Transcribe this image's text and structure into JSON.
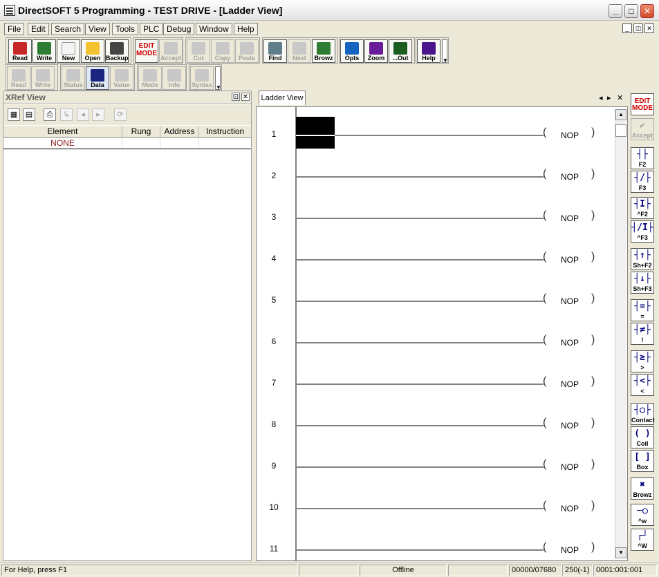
{
  "window": {
    "title": "DirectSOFT 5 Programming - TEST DRIVE - [Ladder View]",
    "minimize": "_",
    "maximize": "□",
    "close": "✕"
  },
  "menu": [
    "File",
    "Edit",
    "Search",
    "View",
    "Tools",
    "PLC",
    "Debug",
    "Window",
    "Help"
  ],
  "toolbar1": [
    {
      "label": "Read",
      "icon": "read-icon",
      "color": "#c62828",
      "enabled": true
    },
    {
      "label": "Write",
      "icon": "write-icon",
      "color": "#2e7d32",
      "enabled": true
    },
    {
      "label": "New",
      "icon": "new-document-icon",
      "color": "#f4f4f4",
      "enabled": true
    },
    {
      "label": "Open",
      "icon": "open-folder-icon",
      "color": "#f2c230",
      "enabled": true
    },
    {
      "label": "Backup",
      "icon": "backup-icon",
      "color": "#444444",
      "enabled": true
    },
    {
      "label": "EDIT MODE",
      "icon": "edit-mode-icon",
      "color": "#d00000",
      "enabled": true
    },
    {
      "label": "Accept",
      "icon": "accept-icon",
      "color": "#c8c8c8",
      "enabled": false
    },
    {
      "label": "Cut",
      "icon": "cut-icon",
      "color": "#c8c8c8",
      "enabled": false
    },
    {
      "label": "Copy",
      "icon": "copy-icon",
      "color": "#c8c8c8",
      "enabled": false
    },
    {
      "label": "Paste",
      "icon": "paste-icon",
      "color": "#c8c8c8",
      "enabled": false
    },
    {
      "label": "Find",
      "icon": "find-icon",
      "color": "#607d8b",
      "enabled": true
    },
    {
      "label": "Next",
      "icon": "next-icon",
      "color": "#c8c8c8",
      "enabled": false
    },
    {
      "label": "Browz",
      "icon": "browse-icon",
      "color": "#2e7d32",
      "enabled": true
    },
    {
      "label": "Opts",
      "icon": "options-icon",
      "color": "#1565c0",
      "enabled": true
    },
    {
      "label": "Zoom",
      "icon": "zoom-icon",
      "color": "#6a1b9a",
      "enabled": true
    },
    {
      "label": "...Out",
      "icon": "zoom-out-icon",
      "color": "#1b5e20",
      "enabled": true
    },
    {
      "label": "Help",
      "icon": "help-icon",
      "color": "#4a148c",
      "enabled": true
    }
  ],
  "toolbar2": [
    {
      "label": "Read",
      "icon": "plc-read-icon",
      "enabled": false
    },
    {
      "label": "Write",
      "icon": "plc-write-icon",
      "enabled": false
    },
    {
      "label": "Status",
      "icon": "status-icon",
      "enabled": false
    },
    {
      "label": "Data",
      "icon": "data-view-icon",
      "enabled": true
    },
    {
      "label": "Value",
      "icon": "value-icon",
      "enabled": false
    },
    {
      "label": "Mode",
      "icon": "mode-icon",
      "enabled": false
    },
    {
      "label": "Info",
      "icon": "info-icon",
      "enabled": false
    },
    {
      "label": "Syntax",
      "icon": "syntax-icon",
      "enabled": false
    }
  ],
  "xref": {
    "title": "XRef View",
    "columns": [
      "Element",
      "Rung",
      "Address",
      "Instruction"
    ],
    "rows": [
      {
        "element": "NONE",
        "rung": "",
        "address": "",
        "instruction": ""
      }
    ]
  },
  "ladder": {
    "tab_label": "Ladder View",
    "rungs": [
      {
        "number": "1",
        "coil": "NOP"
      },
      {
        "number": "2",
        "coil": "NOP"
      },
      {
        "number": "3",
        "coil": "NOP"
      },
      {
        "number": "4",
        "coil": "NOP"
      },
      {
        "number": "5",
        "coil": "NOP"
      },
      {
        "number": "6",
        "coil": "NOP"
      },
      {
        "number": "7",
        "coil": "NOP"
      },
      {
        "number": "8",
        "coil": "NOP"
      },
      {
        "number": "9",
        "coil": "NOP"
      },
      {
        "number": "10",
        "coil": "NOP"
      },
      {
        "number": "11",
        "coil": "NOP"
      }
    ]
  },
  "palette": [
    {
      "sym": "EDIT MODE",
      "key": "",
      "name": "palette-edit-mode-button",
      "enabled": true,
      "edit": true
    },
    {
      "sym": "✔",
      "key": "Accept",
      "name": "palette-accept-button",
      "enabled": false
    },
    {
      "sym": "┤├",
      "key": "F2",
      "name": "palette-normally-open-contact-button",
      "enabled": true
    },
    {
      "sym": "┤/├",
      "key": "F3",
      "name": "palette-normally-closed-contact-button",
      "enabled": true
    },
    {
      "sym": "┤I├",
      "key": "^F2",
      "name": "palette-immediate-open-contact-button",
      "enabled": true
    },
    {
      "sym": "┤/I├",
      "key": "^F3",
      "name": "palette-immediate-closed-contact-button",
      "enabled": true
    },
    {
      "sym": "┤↑├",
      "key": "Sh+F2",
      "name": "palette-rising-edge-contact-button",
      "enabled": true
    },
    {
      "sym": "┤↓├",
      "key": "Sh+F3",
      "name": "palette-falling-edge-contact-button",
      "enabled": true
    },
    {
      "sym": "┤=├",
      "key": "=",
      "name": "palette-equal-compare-button",
      "enabled": true
    },
    {
      "sym": "┤≠├",
      "key": "!",
      "name": "palette-not-equal-compare-button",
      "enabled": true
    },
    {
      "sym": "┤≥├",
      "key": ">",
      "name": "palette-greater-compare-button",
      "enabled": true
    },
    {
      "sym": "┤<├",
      "key": "<",
      "name": "palette-less-compare-button",
      "enabled": true
    },
    {
      "sym": "┤○├",
      "key": "Contact",
      "name": "palette-contact-button",
      "enabled": true
    },
    {
      "sym": "( )",
      "key": "Coil",
      "name": "palette-coil-button",
      "enabled": true
    },
    {
      "sym": "[ ]",
      "key": "Box",
      "name": "palette-box-button",
      "enabled": true
    },
    {
      "sym": "✖",
      "key": "Browz",
      "name": "palette-browse-button",
      "enabled": true
    },
    {
      "sym": "─○",
      "key": "^w",
      "name": "palette-wire-button",
      "enabled": true
    },
    {
      "sym": "┌┘",
      "key": "^W",
      "name": "palette-wire-line-button",
      "enabled": true
    }
  ],
  "status": {
    "help": "For Help, press F1",
    "mode": "Offline",
    "memory": "00000/07680",
    "cursor": "250(-1)",
    "position": "0001:001:001"
  }
}
